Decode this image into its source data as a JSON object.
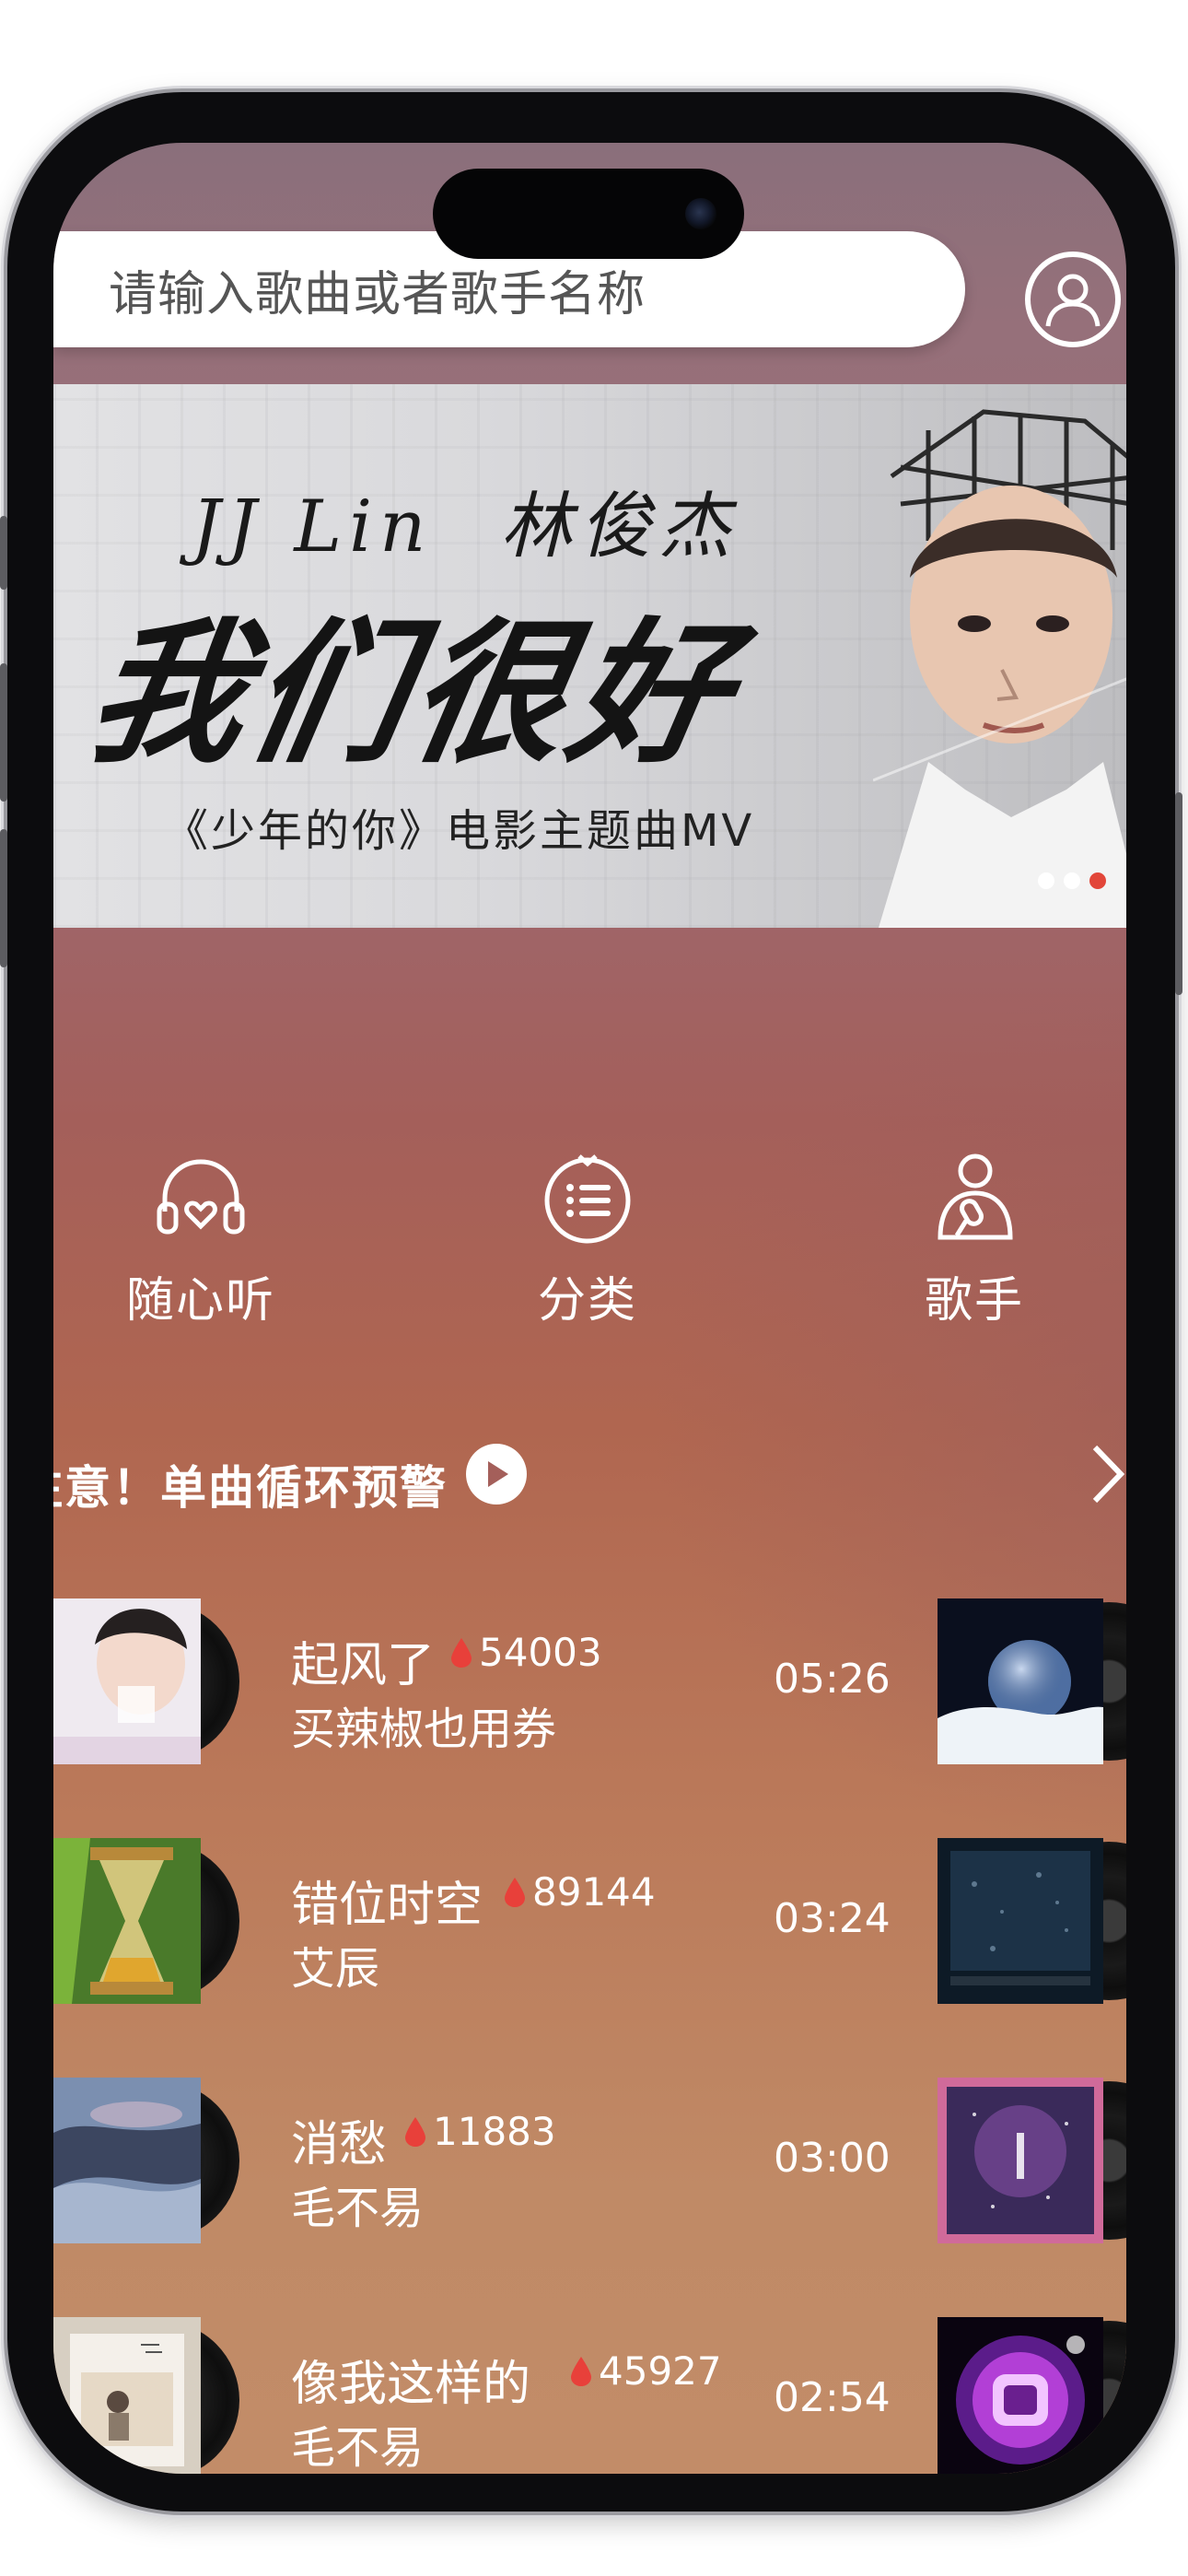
{
  "search": {
    "placeholder": "请输入歌曲或者歌手名称"
  },
  "banner": {
    "artist_en": "JJ Lin",
    "artist_cn": "林俊杰",
    "title": "我们很好",
    "subtitle": "《少年的你》电影主题曲MV",
    "page_count": 3,
    "active_page": 3
  },
  "categories": [
    {
      "label": "随心听",
      "icon": "headphones-heart-icon"
    },
    {
      "label": "分类",
      "icon": "category-list-icon"
    },
    {
      "label": "歌手",
      "icon": "singer-microphone-icon"
    }
  ],
  "section": {
    "title": "注意！单曲循环预警"
  },
  "songs": [
    {
      "title": "起风了",
      "artist": "买辣椒也用券",
      "heat": "54003",
      "duration": "05:26"
    },
    {
      "title": "错位时空",
      "artist": "艾辰",
      "heat": "89144",
      "duration": "03:24"
    },
    {
      "title": "消愁",
      "artist": "毛不易",
      "heat": "11883",
      "duration": "03:00"
    },
    {
      "title": "像我这样的",
      "artist": "毛不易",
      "heat": "45927",
      "duration": "02:54"
    }
  ],
  "colors": {
    "accent_dot": "#e24639",
    "heat_drop": "#e8403a"
  }
}
